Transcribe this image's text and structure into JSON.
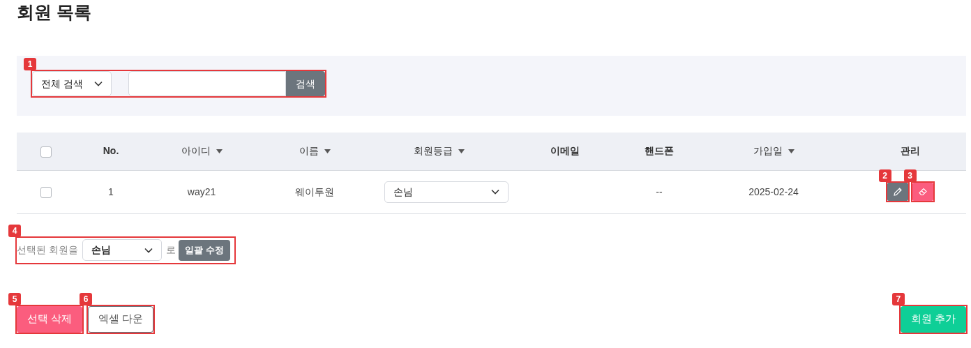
{
  "title": "회원 목록",
  "search": {
    "marker": "1",
    "scope": "전체 검색",
    "button": "검색"
  },
  "table": {
    "select_all": {
      "checked": false
    },
    "columns": [
      {
        "label": "No.",
        "sortable": false
      },
      {
        "label": "아이디",
        "sortable": true
      },
      {
        "label": "이름",
        "sortable": true
      },
      {
        "label": "회원등급",
        "sortable": true
      },
      {
        "label": "이메일",
        "sortable": false
      },
      {
        "label": "핸드폰",
        "sortable": false
      },
      {
        "label": "가입일",
        "sortable": true
      },
      {
        "label": "관리",
        "sortable": false
      }
    ],
    "rows": [
      {
        "checked": false,
        "cells": [
          {
            "kind": "text",
            "text": "1"
          },
          {
            "kind": "text",
            "text": "way21"
          },
          {
            "kind": "text",
            "text": "웨이투원"
          },
          {
            "kind": "select",
            "value": "손님"
          },
          {
            "kind": "empty"
          },
          {
            "kind": "text",
            "text": "--"
          },
          {
            "kind": "text",
            "text": "2025-02-24"
          },
          {
            "kind": "actions",
            "actions": [
              {
                "kind": "edit",
                "marker": "2"
              },
              {
                "kind": "delete",
                "marker": "3"
              }
            ]
          }
        ]
      }
    ]
  },
  "bulk": {
    "marker": "4",
    "prefix": "선택된 회원을",
    "value": "손님",
    "suffix": "로",
    "button": "일괄 수정"
  },
  "footer_buttons": [
    {
      "kind": "delete",
      "label": "선택 삭제",
      "marker": "5"
    },
    {
      "kind": "excel",
      "label": "엑셀 다운",
      "marker": "6"
    },
    {
      "kind": "add",
      "label": "회원 추가",
      "marker": "7"
    }
  ]
}
